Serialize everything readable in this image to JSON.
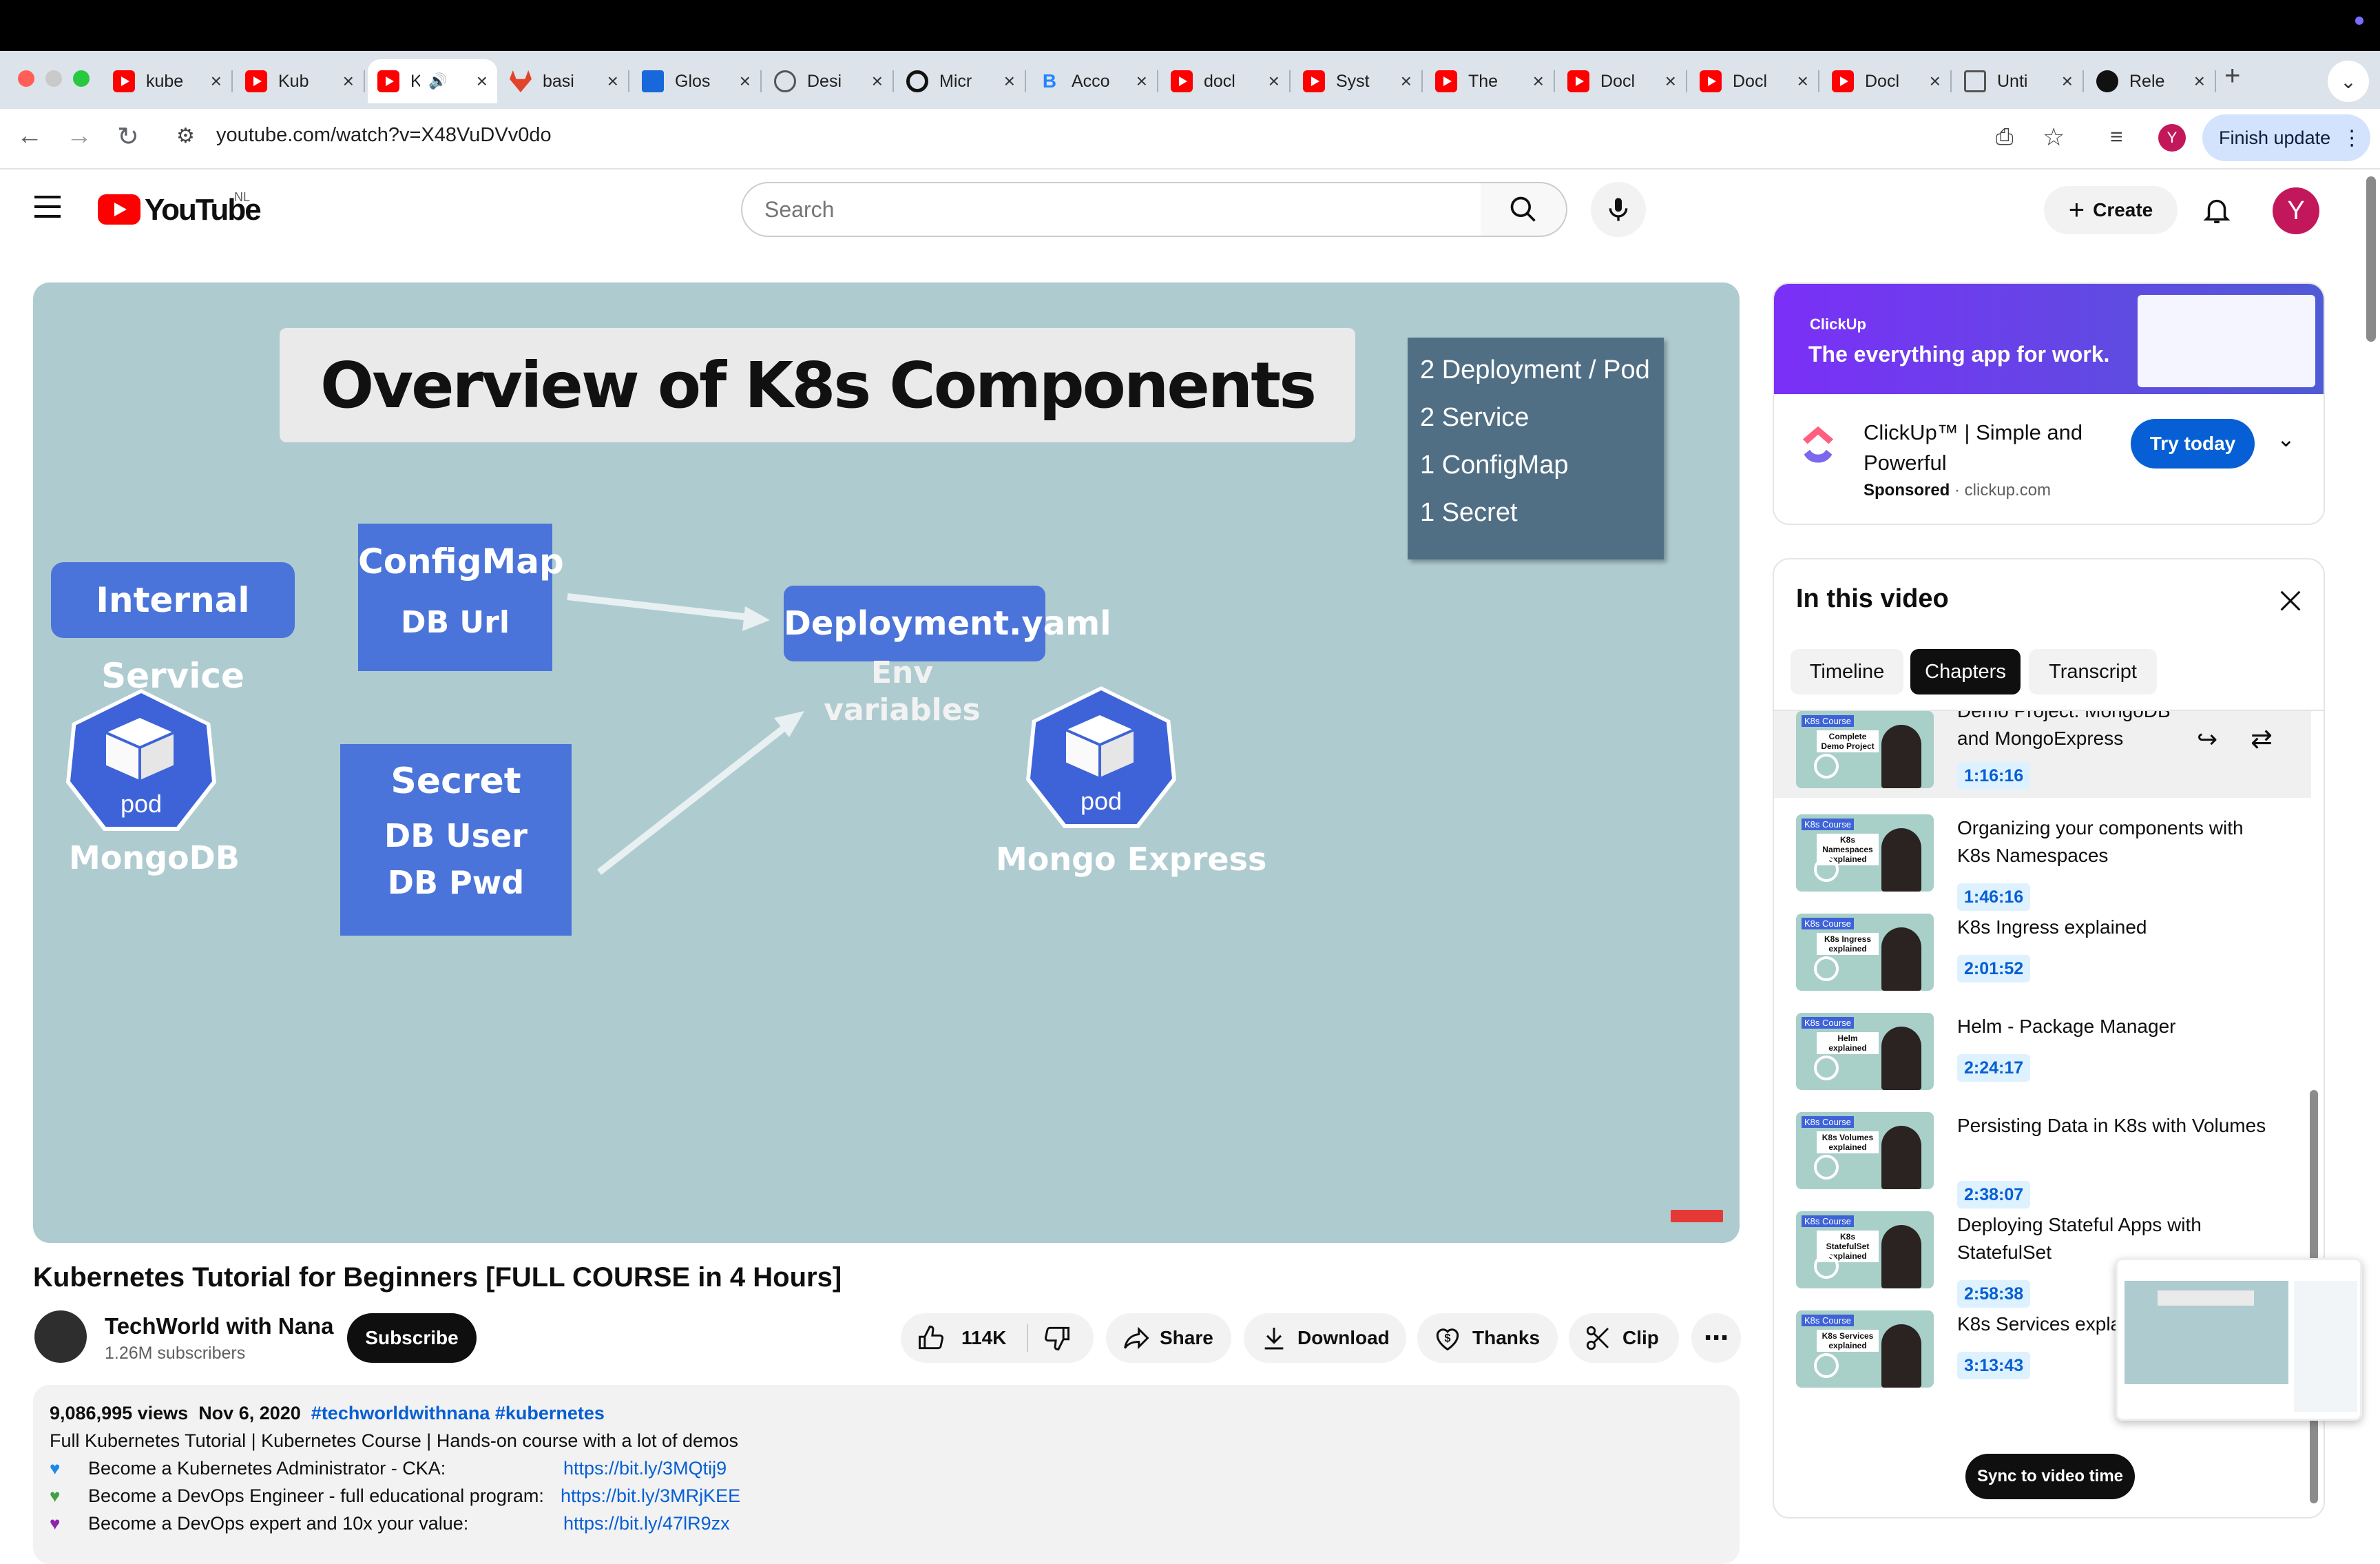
{
  "browser": {
    "tabs": [
      {
        "title": "kube",
        "icon": "youtube-icon"
      },
      {
        "title": "Kub",
        "icon": "youtube-icon"
      },
      {
        "title": "K",
        "icon": "youtube-icon",
        "active": true,
        "audio": true
      },
      {
        "title": "basi",
        "icon": "gitlab-icon"
      },
      {
        "title": "Glos",
        "icon": "confluence-icon"
      },
      {
        "title": "Desi",
        "icon": "globe-icon"
      },
      {
        "title": "Micr",
        "icon": "openai-icon"
      },
      {
        "title": "Acco",
        "icon": "bitbucket-icon"
      },
      {
        "title": "docl",
        "icon": "youtube-icon"
      },
      {
        "title": "Syst",
        "icon": "youtube-icon"
      },
      {
        "title": "The",
        "icon": "youtube-icon"
      },
      {
        "title": "Docl",
        "icon": "youtube-icon"
      },
      {
        "title": "Docl",
        "icon": "youtube-icon"
      },
      {
        "title": "Docl",
        "icon": "youtube-icon"
      },
      {
        "title": "Unti",
        "icon": "diagram-icon"
      },
      {
        "title": "Rele",
        "icon": "github-icon"
      }
    ],
    "url": "youtube.com/watch?v=X48VuDVv0do",
    "profile_initial": "Y",
    "finish_update": "Finish update"
  },
  "youtube": {
    "logo_text": "YouTube",
    "country": "NL",
    "search_placeholder": "Search",
    "create_label": "Create",
    "avatar_initial": "Y"
  },
  "slide": {
    "title": "Overview of K8s Components",
    "summary": [
      "2 Deployment / Pod",
      "2 Service",
      "1 ConfigMap",
      "1 Secret"
    ],
    "internal_service": "Internal Service",
    "configmap_title": "ConfigMap",
    "configmap_sub": "DB Url",
    "deployment": "Deployment.yaml",
    "env_line1": "Env",
    "env_line2": "variables",
    "secret_title": "Secret",
    "secret_line1": "DB User",
    "secret_line2": "DB Pwd",
    "pod_label": "pod",
    "mongodb": "MongoDB",
    "mongo_express": "Mongo Express"
  },
  "video": {
    "title": "Kubernetes Tutorial for Beginners [FULL COURSE in 4 Hours]",
    "channel": "TechWorld with Nana",
    "subscribers": "1.26M subscribers",
    "subscribe": "Subscribe",
    "likes": "114K",
    "share": "Share",
    "download": "Download",
    "thanks": "Thanks",
    "clip": "Clip"
  },
  "description": {
    "views": "9,086,995 views",
    "date": "Nov 6, 2020",
    "tags": "#techworldwithnana #kubernetes",
    "line1": "Full Kubernetes Tutorial | Kubernetes Course | Hands-on course with a lot of demos",
    "items": [
      {
        "heart": "💙",
        "heart_color": "#1e88e5",
        "text": "Become a Kubernetes Administrator - CKA:",
        "link": "https://bit.ly/3MQtij9"
      },
      {
        "heart": "💚",
        "heart_color": "#43a047",
        "text": "Become a DevOps Engineer - full educational program:",
        "link": "https://bit.ly/3MRjKEE"
      },
      {
        "heart": "💜",
        "heart_color": "#8e24aa",
        "text": "Become a DevOps expert and 10x your value:",
        "link": "https://bit.ly/47lR9zx"
      }
    ]
  },
  "ad": {
    "banner_brand": "ClickUp",
    "banner_tagline": "The everything app for work.",
    "title": "ClickUp™ | Simple and Powerful",
    "sponsored": "Sponsored",
    "domain": "clickup.com",
    "cta": "Try today"
  },
  "chapters_panel": {
    "title": "In this video",
    "tabs": [
      "Timeline",
      "Chapters",
      "Transcript"
    ],
    "active_tab": "Chapters",
    "chapters": [
      {
        "title": "Demo Project: MongoDB and MongoExpress",
        "time": "1:16:16",
        "thumb_text": "Complete Demo Project",
        "current": true
      },
      {
        "title": "Organizing your components with K8s Namespaces",
        "time": "1:46:16",
        "thumb_text": "K8s Namespaces explained"
      },
      {
        "title": "K8s Ingress explained",
        "time": "2:01:52",
        "thumb_text": "K8s Ingress explained"
      },
      {
        "title": "Helm - Package Manager",
        "time": "2:24:17",
        "thumb_text": "Helm explained"
      },
      {
        "title": "Persisting Data in K8s with Volumes",
        "time": "2:38:07",
        "thumb_text": "K8s Volumes explained"
      },
      {
        "title": "Deploying Stateful Apps with StatefulSet",
        "time": "2:58:38",
        "thumb_text": "K8s StatefulSet explained"
      },
      {
        "title": "K8s Services expla",
        "time": "3:13:43",
        "thumb_text": "K8s Services explained"
      }
    ],
    "thumb_badge": "K8s Course",
    "sync": "Sync to video time"
  }
}
